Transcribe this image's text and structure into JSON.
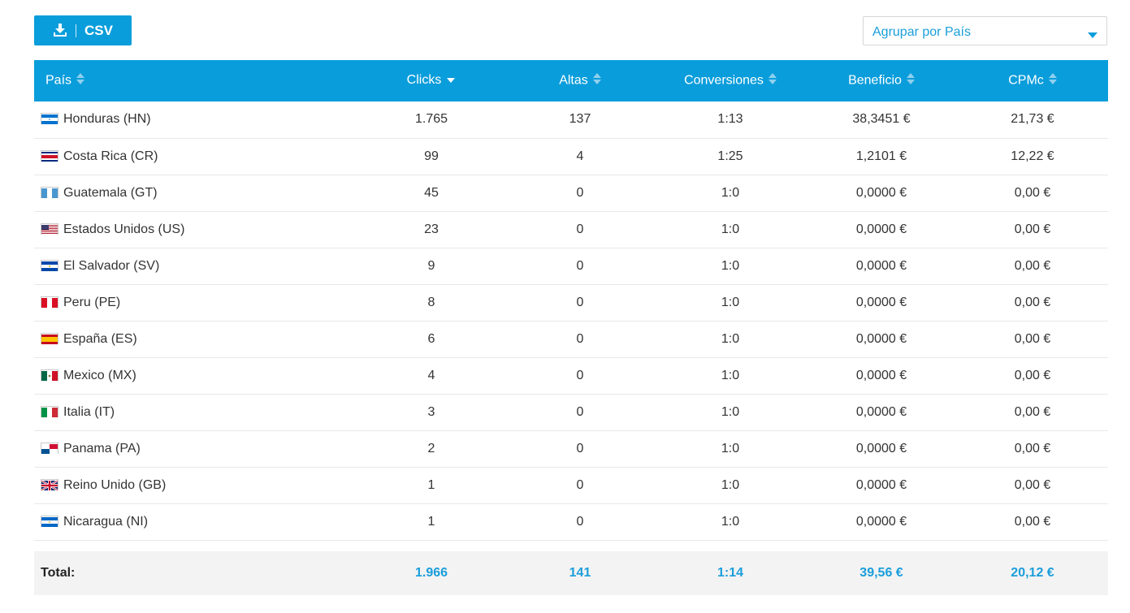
{
  "toolbar": {
    "csv_label": "CSV",
    "download_icon": "download-icon"
  },
  "group_select": {
    "value": "Agrupar por País",
    "icon": "caret-down-icon"
  },
  "colors": {
    "accent": "#0a9ddb",
    "total_text": "#1a9edb",
    "total_bg": "#f3f3f3"
  },
  "table": {
    "columns": [
      {
        "label": "País",
        "sort": "both"
      },
      {
        "label": "Clicks",
        "sort": "desc"
      },
      {
        "label": "Altas",
        "sort": "both"
      },
      {
        "label": "Conversiones",
        "sort": "both"
      },
      {
        "label": "Beneficio",
        "sort": "both"
      },
      {
        "label": "CPMc",
        "sort": "both"
      }
    ],
    "rows": [
      {
        "country": "Honduras (HN)",
        "flag": "hn",
        "clicks": "1.765",
        "altas": "137",
        "conv": "1:13",
        "beneficio": "38,3451 €",
        "cpmc": "21,73 €"
      },
      {
        "country": "Costa Rica (CR)",
        "flag": "cr",
        "clicks": "99",
        "altas": "4",
        "conv": "1:25",
        "beneficio": "1,2101 €",
        "cpmc": "12,22 €"
      },
      {
        "country": "Guatemala (GT)",
        "flag": "gt",
        "clicks": "45",
        "altas": "0",
        "conv": "1:0",
        "beneficio": "0,0000 €",
        "cpmc": "0,00 €"
      },
      {
        "country": "Estados Unidos (US)",
        "flag": "us",
        "clicks": "23",
        "altas": "0",
        "conv": "1:0",
        "beneficio": "0,0000 €",
        "cpmc": "0,00 €"
      },
      {
        "country": "El Salvador (SV)",
        "flag": "sv",
        "clicks": "9",
        "altas": "0",
        "conv": "1:0",
        "beneficio": "0,0000 €",
        "cpmc": "0,00 €"
      },
      {
        "country": "Peru (PE)",
        "flag": "pe",
        "clicks": "8",
        "altas": "0",
        "conv": "1:0",
        "beneficio": "0,0000 €",
        "cpmc": "0,00 €"
      },
      {
        "country": "España (ES)",
        "flag": "es",
        "clicks": "6",
        "altas": "0",
        "conv": "1:0",
        "beneficio": "0,0000 €",
        "cpmc": "0,00 €"
      },
      {
        "country": "Mexico (MX)",
        "flag": "mx",
        "clicks": "4",
        "altas": "0",
        "conv": "1:0",
        "beneficio": "0,0000 €",
        "cpmc": "0,00 €"
      },
      {
        "country": "Italia (IT)",
        "flag": "it",
        "clicks": "3",
        "altas": "0",
        "conv": "1:0",
        "beneficio": "0,0000 €",
        "cpmc": "0,00 €"
      },
      {
        "country": "Panama (PA)",
        "flag": "pa",
        "clicks": "2",
        "altas": "0",
        "conv": "1:0",
        "beneficio": "0,0000 €",
        "cpmc": "0,00 €"
      },
      {
        "country": "Reino Unido (GB)",
        "flag": "gb",
        "clicks": "1",
        "altas": "0",
        "conv": "1:0",
        "beneficio": "0,0000 €",
        "cpmc": "0,00 €"
      },
      {
        "country": "Nicaragua (NI)",
        "flag": "ni",
        "clicks": "1",
        "altas": "0",
        "conv": "1:0",
        "beneficio": "0,0000 €",
        "cpmc": "0,00 €"
      }
    ],
    "total": {
      "label": "Total:",
      "clicks": "1.966",
      "altas": "141",
      "conv": "1:14",
      "beneficio": "39,56 €",
      "cpmc": "20,12 €"
    }
  }
}
